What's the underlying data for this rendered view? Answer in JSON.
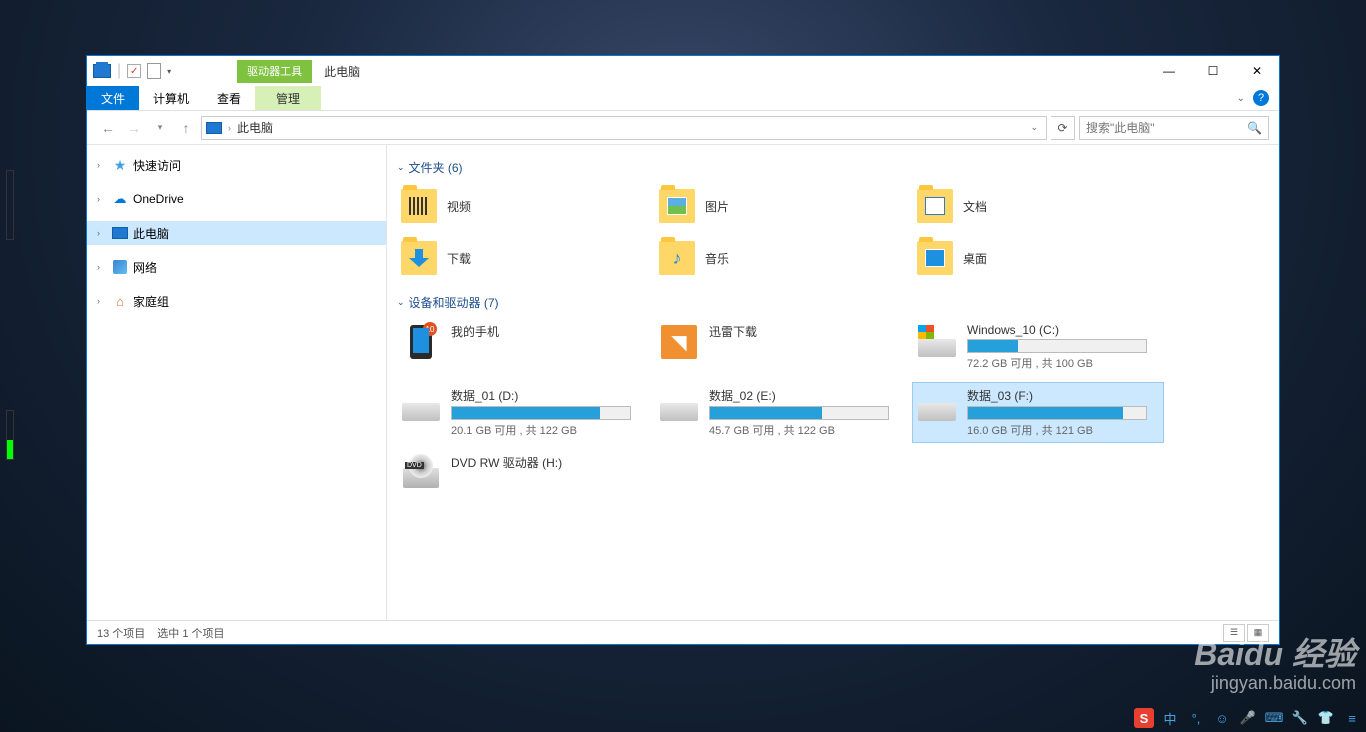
{
  "window": {
    "ribbon_extra": "驱动器工具",
    "title": "此电脑",
    "tabs": {
      "file": "文件",
      "computer": "计算机",
      "view": "查看",
      "manage": "管理"
    }
  },
  "address": {
    "path": "此电脑",
    "search_placeholder": "搜索\"此电脑\""
  },
  "navpane": {
    "quick": "快速访问",
    "onedrive": "OneDrive",
    "thispc": "此电脑",
    "network": "网络",
    "homegroup": "家庭组"
  },
  "groups": {
    "folders": "文件夹 (6)",
    "devices": "设备和驱动器 (7)"
  },
  "folders": [
    {
      "label": "视频"
    },
    {
      "label": "图片"
    },
    {
      "label": "文档"
    },
    {
      "label": "下载"
    },
    {
      "label": "音乐"
    },
    {
      "label": "桌面"
    }
  ],
  "devices": {
    "phone": "我的手机",
    "phone_badge": "10",
    "xunlei": "迅雷下载",
    "c": {
      "name": "Windows_10 (C:)",
      "free": "72.2 GB 可用 , 共 100 GB",
      "pct": 28
    },
    "d": {
      "name": "数据_01 (D:)",
      "free": "20.1 GB 可用 , 共 122 GB",
      "pct": 83
    },
    "e": {
      "name": "数据_02 (E:)",
      "free": "45.7 GB 可用 , 共 122 GB",
      "pct": 63
    },
    "f": {
      "name": "数据_03 (F:)",
      "free": "16.0 GB 可用 , 共 121 GB",
      "pct": 87
    },
    "dvd": "DVD RW 驱动器 (H:)"
  },
  "status": {
    "items": "13 个项目",
    "selected": "选中 1 个项目"
  },
  "watermark": {
    "brand": "Baidu 经验",
    "url": "jingyan.baidu.com"
  },
  "tray": {
    "ime": "中"
  }
}
